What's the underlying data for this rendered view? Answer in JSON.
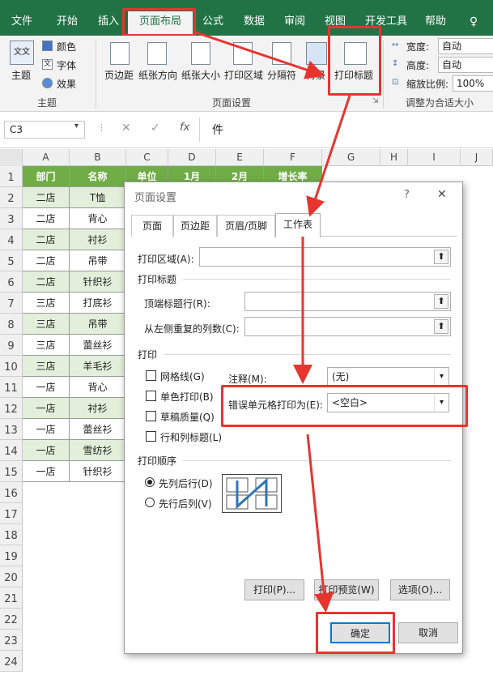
{
  "ribbon_tabs": [
    "文件",
    "开始",
    "插入",
    "页面布局",
    "公式",
    "数据",
    "审阅",
    "视图",
    "开发工具",
    "帮助"
  ],
  "ribbon": {
    "theme": "主题",
    "colors": "颜色",
    "fonts": "字体",
    "effects": "效果",
    "theme_group": "主题",
    "margins": "页边距",
    "orientation": "纸张方向",
    "size": "纸张大小",
    "print_area": "打印区域",
    "breaks": "分隔符",
    "background": "背景",
    "print_titles": "打印标题",
    "page_setup_group": "页面设置",
    "width_label": "宽度:",
    "width_value": "自动",
    "height_label": "高度:",
    "height_value": "自动",
    "scale_label": "缩放比例:",
    "scale_value": "100%",
    "scale_group": "调整为合适大小"
  },
  "formula_bar": {
    "name_box": "C3",
    "fx": "fx",
    "content": "件"
  },
  "columns": [
    "A",
    "B",
    "C",
    "D",
    "E",
    "F",
    "G",
    "H",
    "I",
    "J"
  ],
  "rows": [
    "1",
    "2",
    "3",
    "4",
    "5",
    "6",
    "7",
    "8",
    "9",
    "10",
    "11",
    "12",
    "13",
    "14",
    "15",
    "16",
    "17",
    "18",
    "19",
    "20",
    "21",
    "22",
    "23",
    "24"
  ],
  "header_row": [
    "部门",
    "名称",
    "单位",
    "1月",
    "2月",
    "增长率"
  ],
  "data_rows": [
    {
      "dept": "二店",
      "name": "T恤"
    },
    {
      "dept": "二店",
      "name": "背心"
    },
    {
      "dept": "二店",
      "name": "衬衫"
    },
    {
      "dept": "二店",
      "name": "吊带"
    },
    {
      "dept": "二店",
      "name": "针织衫"
    },
    {
      "dept": "三店",
      "name": "打底衫"
    },
    {
      "dept": "三店",
      "name": "吊带"
    },
    {
      "dept": "三店",
      "name": "蕾丝衫"
    },
    {
      "dept": "三店",
      "name": "羊毛衫"
    },
    {
      "dept": "一店",
      "name": "背心"
    },
    {
      "dept": "一店",
      "name": "衬衫"
    },
    {
      "dept": "一店",
      "name": "蕾丝衫"
    },
    {
      "dept": "一店",
      "name": "雪纺衫"
    },
    {
      "dept": "一店",
      "name": "针织衫"
    }
  ],
  "dialog": {
    "title": "页面设置",
    "help": "?",
    "close": "✕",
    "tabs": [
      "页面",
      "页边距",
      "页眉/页脚",
      "工作表"
    ],
    "print_area_label": "打印区域(A):",
    "print_titles_section": "打印标题",
    "rows_repeat_label": "顶端标题行(R):",
    "cols_repeat_label": "从左侧重复的列数(C):",
    "print_section": "打印",
    "gridlines": "网格线(G)",
    "black_white": "单色打印(B)",
    "draft": "草稿质量(Q)",
    "row_col_headings": "行和列标题(L)",
    "comments_label": "注释(M):",
    "comments_value": "(无)",
    "errors_label": "错误单元格打印为(E):",
    "errors_value": "<空白>",
    "order_section": "打印顺序",
    "down_then_over": "先列后行(D)",
    "over_then_down": "先行后列(V)",
    "print_btn": "打印(P)...",
    "preview_btn": "打印预览(W)",
    "options_btn": "选项(O)...",
    "ok_btn": "确定",
    "cancel_btn": "取消"
  },
  "colors": {
    "excel_green": "#217346",
    "header_fill": "#70ad47",
    "alt_fill": "#e2efda",
    "annotation_red": "#e8342f",
    "focus_blue": "#0078d7"
  }
}
